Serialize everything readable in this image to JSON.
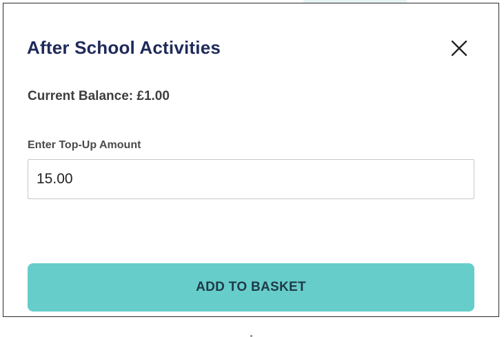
{
  "dialog": {
    "title": "After School Activities",
    "close_icon": "close-icon",
    "balance_text": "Current Balance: £1.00",
    "topup": {
      "label": "Enter Top-Up Amount",
      "value": "15.00"
    },
    "add_button_label": "ADD TO BASKET"
  },
  "colors": {
    "title": "#1f2a5a",
    "button_bg": "#66cdcb",
    "button_text": "#1f3a46",
    "border": "#2b2b2b"
  }
}
